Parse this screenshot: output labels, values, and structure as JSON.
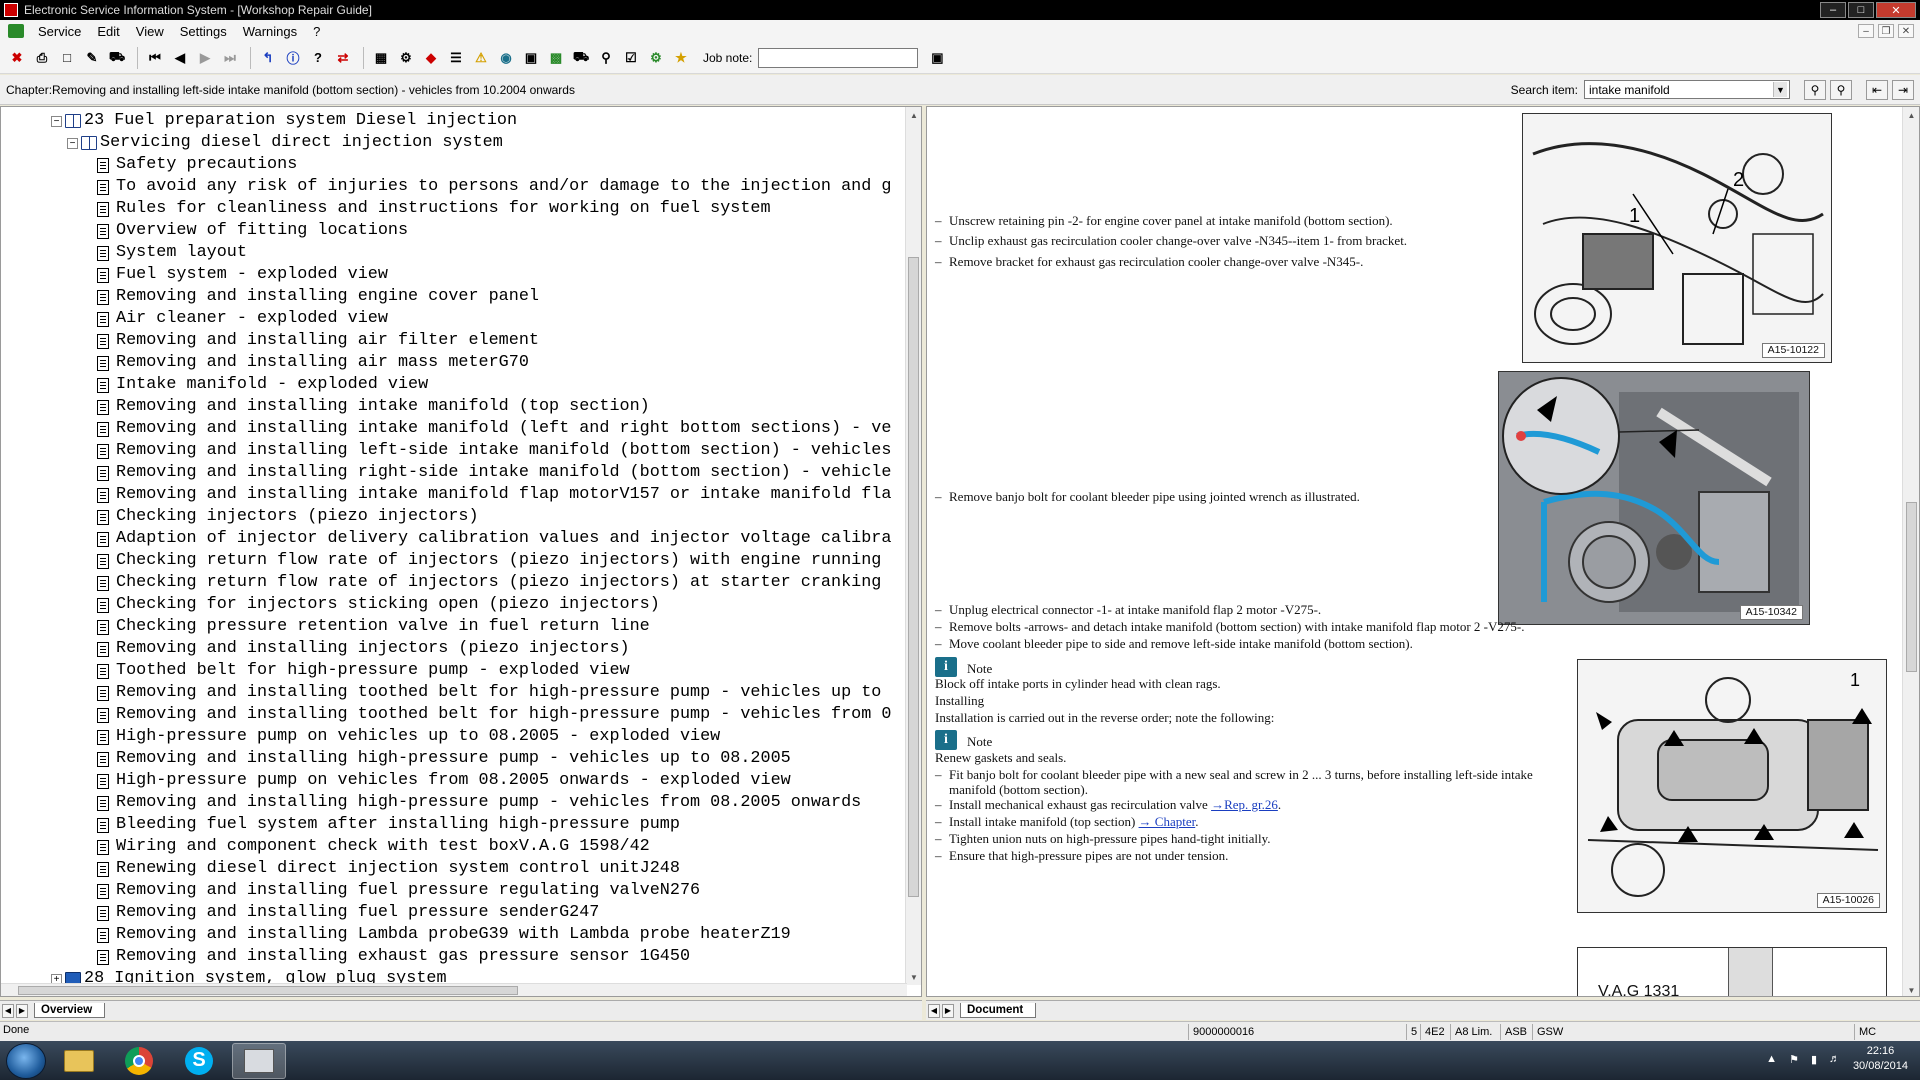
{
  "window": {
    "title": "Electronic Service Information System - [Workshop Repair Guide]"
  },
  "menu": [
    "Service",
    "Edit",
    "View",
    "Settings",
    "Warnings",
    "?"
  ],
  "toolbar": {
    "job_note_label": "Job note:",
    "job_note_value": ""
  },
  "chapter_bar": {
    "chapter": "Chapter:Removing and installing left-side intake manifold (bottom section) - vehicles from 10.2004 onwards",
    "search_label": "Search item:",
    "search_value": "intake manifold"
  },
  "tree": {
    "group_23": "23 Fuel preparation system Diesel injection",
    "subgroup": "Servicing diesel direct injection system",
    "items": [
      "Safety precautions",
      "To avoid any risk of injuries to persons and/or damage to the injection and g",
      "Rules for cleanliness and instructions for working on fuel system",
      "Overview of fitting locations",
      "System layout",
      "Fuel system - exploded view",
      "Removing and installing engine cover panel",
      "Air cleaner - exploded view",
      "Removing and installing air filter element",
      "Removing and installing air mass meterG70",
      "Intake manifold - exploded view",
      "Removing and installing intake manifold (top section)",
      "Removing and installing intake manifold (left and right bottom sections) - ve",
      "Removing and installing left-side intake manifold (bottom section) - vehicles",
      "Removing and installing right-side intake manifold (bottom section) - vehicle",
      "Removing and installing intake manifold flap motorV157 or intake manifold fla",
      "Checking injectors (piezo injectors)",
      "Adaption of injector delivery calibration values and injector voltage calibra",
      "Checking return flow rate of injectors (piezo injectors) with engine running",
      "Checking return flow rate of injectors (piezo injectors) at starter cranking",
      "Checking for injectors sticking open (piezo injectors)",
      "Checking pressure retention valve in fuel return line",
      "Removing and installing injectors (piezo injectors)",
      "Toothed belt for high-pressure pump - exploded view",
      "Removing and installing toothed belt for high-pressure pump - vehicles up to",
      "Removing and installing toothed belt for high-pressure pump - vehicles from 0",
      "High-pressure pump on vehicles up to 08.2005 - exploded view",
      "Removing and installing high-pressure pump - vehicles up to 08.2005",
      "High-pressure pump on vehicles from 08.2005 onwards - exploded view",
      "Removing and installing high-pressure pump - vehicles from 08.2005 onwards",
      "Bleeding fuel system after installing high-pressure pump",
      "Wiring and component check with test boxV.A.G 1598/42",
      "Renewing diesel direct injection system control unitJ248",
      "Removing and installing fuel pressure regulating valveN276",
      "Removing and installing fuel pressure senderG247",
      "Removing and installing Lambda probeG39 with Lambda probe heaterZ19",
      "Removing and installing exhaust gas pressure sensor 1G450"
    ],
    "group_28": "28 Ignition system, glow plug system"
  },
  "left_tab": "Overview",
  "right_tab": "Document",
  "doc": {
    "step1": "Unscrew retaining pin -2- for engine cover panel at intake manifold (bottom section).",
    "step2": "Unclip exhaust gas recirculation cooler change-over valve -N345--item 1- from bracket.",
    "step3": "Remove bracket for exhaust gas recirculation cooler change-over valve -N345-.",
    "step4": "Remove banjo bolt for coolant bleeder pipe using jointed wrench as illustrated.",
    "step5": "Unplug electrical connector -1- at intake manifold flap 2 motor -V275-.",
    "step6": "Remove bolts -arrows- and detach intake manifold (bottom section) with intake manifold flap motor 2 -V275-.",
    "step7": "Move coolant bleeder pipe to side and remove left-side intake manifold (bottom section).",
    "note_label": "Note",
    "note1": "Block off intake ports in cylinder head with clean rags.",
    "installing": "Installing",
    "install_text": "Installation is carried out in the reverse order; note the following:",
    "note2": "Renew gaskets and seals.",
    "step8a": "Fit banjo bolt for coolant bleeder pipe with a new seal and screw in 2 ... 3 turns, before installing left-side intake",
    "step8b": "manifold (bottom section).",
    "step9": "Install mechanical exhaust gas recirculation valve",
    "step9_link": "→Rep. gr.26",
    "step10": "Install intake manifold (top section)",
    "step10_link": "→ Chapter",
    "step11": "Tighten union nuts on high-pressure pipes hand-tight initially.",
    "step12": "Ensure that high-pressure pipes are not under tension.",
    "fig1": "A15-10122",
    "fig2": "A15-10342",
    "fig3": "A15-10026",
    "fig4_text": "V.A.G 1331"
  },
  "status": {
    "state": "Done",
    "code": "9000000016",
    "f1": "5",
    "f2": "4E2",
    "f3": "A8 Lim.",
    "f4": "ASB",
    "f5": "GSW",
    "f6": "MC"
  },
  "taskbar": {
    "time": "22:16",
    "date": "30/08/2014"
  }
}
